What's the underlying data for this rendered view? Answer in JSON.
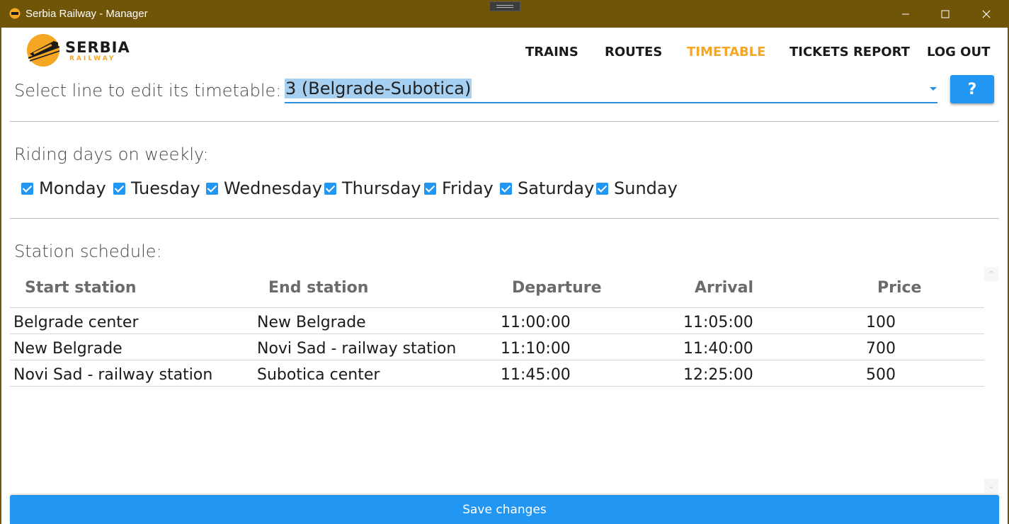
{
  "window": {
    "title": "Serbia Railway - Manager",
    "icon": "train-logo-icon"
  },
  "logo": {
    "line1": "SERBIA",
    "line2": "RAILWAY",
    "color_accent": "#f5a623"
  },
  "nav": {
    "items": [
      {
        "label": "TRAINS",
        "active": false
      },
      {
        "label": "ROUTES",
        "active": false
      },
      {
        "label": "TIMETABLE",
        "active": true
      },
      {
        "label": "TICKETS REPORT",
        "active": false
      },
      {
        "label": "LOG OUT",
        "active": false
      }
    ]
  },
  "line_select": {
    "label": "Select line to edit its timetable:",
    "value": "3 (Belgrade-Subotica)",
    "help_label": "?"
  },
  "riding_days": {
    "label": "Riding days on weekly:",
    "days": [
      {
        "label": "Monday",
        "checked": true
      },
      {
        "label": "Tuesday",
        "checked": true
      },
      {
        "label": "Wednesday",
        "checked": true
      },
      {
        "label": "Thursday",
        "checked": true
      },
      {
        "label": "Friday",
        "checked": true
      },
      {
        "label": "Saturday",
        "checked": true
      },
      {
        "label": "Sunday",
        "checked": true
      }
    ]
  },
  "schedule": {
    "label": "Station schedule:",
    "columns": [
      "Start station",
      "End station",
      "Departure",
      "Arrival",
      "Price"
    ],
    "rows": [
      [
        "Belgrade center",
        "New Belgrade",
        "11:00:00",
        "11:05:00",
        "100"
      ],
      [
        "New Belgrade",
        "Novi Sad - railway station",
        "11:10:00",
        "11:40:00",
        "700"
      ],
      [
        "Novi Sad - railway station",
        "Subotica center",
        "11:45:00",
        "12:25:00",
        "500"
      ]
    ]
  },
  "save_button": {
    "label": "Save changes"
  },
  "colors": {
    "titlebar": "#705508",
    "accent": "#2196f3",
    "active_nav": "#f5a623"
  }
}
